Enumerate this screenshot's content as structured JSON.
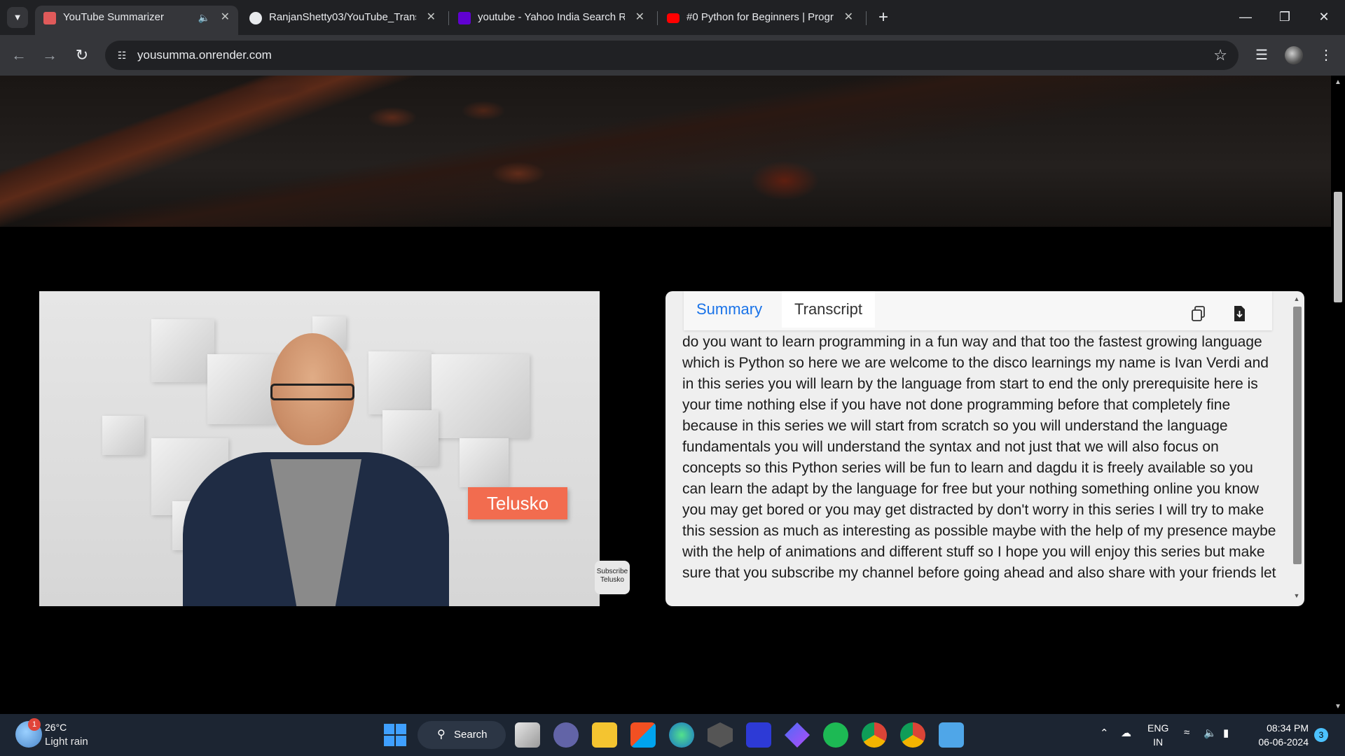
{
  "browser": {
    "tabs": [
      {
        "title": "YouTube Summarizer"
      },
      {
        "title": "RanjanShetty03/YouTube_Trans"
      },
      {
        "title": "youtube - Yahoo India Search R"
      },
      {
        "title": "#0 Python for Beginners | Progr"
      }
    ],
    "url": "yousumma.onrender.com",
    "new_tab": "+",
    "controls": {
      "minimize": "—",
      "restore": "❐",
      "close": "✕"
    }
  },
  "video": {
    "channel_name": "Telusko",
    "subscribe_line1": "Subscribe",
    "subscribe_line2": "Telusko"
  },
  "panel": {
    "tabs": {
      "summary": "Summary",
      "transcript": "Transcript"
    },
    "text": "do you want to learn programming in a fun way and that too the fastest growing language which is Python so here we are welcome to the disco learnings my name is Ivan Verdi and in this series you will learn by the language from start to end the only prerequisite here is your time nothing else if you have not done programming before that completely fine because in this series we will start from scratch so you will understand the language fundamentals you will understand the syntax and not just that we will also focus on concepts so this Python series will be fun to learn and dagdu it is freely available so you can learn the adapt by the language for free but your nothing something online you know you may get bored or you may get distracted by don't worry in this series I will try to make this session as much as interesting as possible maybe with the help of my presence maybe with the help of animations and different stuff so I hope you will enjoy this series but make sure that you subscribe my channel before going ahead and also share with your friends let"
  },
  "taskbar": {
    "weather_badge": "1",
    "temperature": "26°C",
    "weather": "Light rain",
    "search": "Search",
    "lang_line1": "ENG",
    "lang_line2": "IN",
    "time": "08:34 PM",
    "date": "06-06-2024",
    "notifications": "3"
  },
  "colors": {
    "chrome_dark": "#202124",
    "chrome_toolbar": "#35363a",
    "accent": "#1a73e8",
    "channel_badge": "#f26c4f",
    "taskbar": "#1c2532"
  }
}
